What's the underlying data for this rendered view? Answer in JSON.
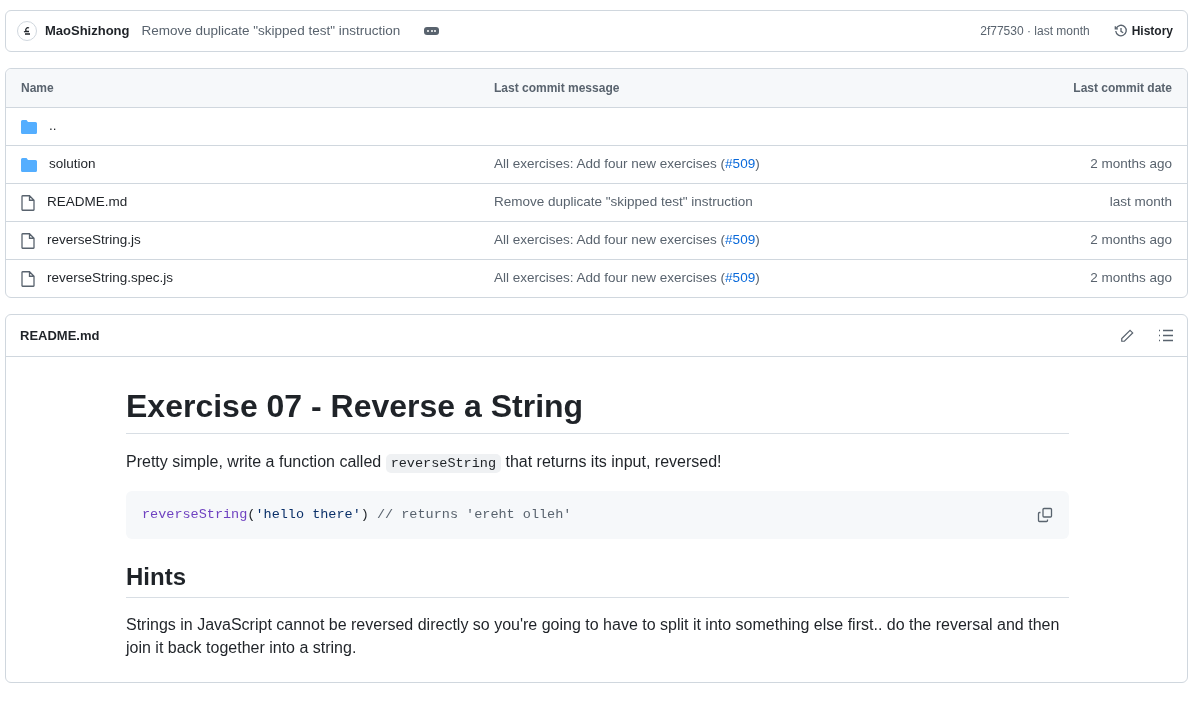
{
  "commit_bar": {
    "author": "MaoShizhong",
    "message": "Remove duplicate \"skipped test\" instruction",
    "meta": "2f77530 · last month",
    "history_button": "History"
  },
  "table": {
    "columns": [
      "Name",
      "Last commit message",
      "Last commit date"
    ],
    "rows": [
      {
        "kind": "folder",
        "name": ".."
      },
      {
        "kind": "folder",
        "name": "solution",
        "message": "All exercises: Add four new exercises (",
        "link": "#509",
        "after": ")",
        "date": "2 months ago"
      },
      {
        "kind": "file",
        "name": "README.md",
        "message": "Remove duplicate \"skipped test\" instruction",
        "date": "last month"
      },
      {
        "kind": "file",
        "name": "reverseString.js",
        "message": "All exercises: Add four new exercises (",
        "link": "#509",
        "after": ")",
        "date": "2 months ago"
      },
      {
        "kind": "file",
        "name": "reverseString.spec.js",
        "message": "All exercises: Add four new exercises (",
        "link": "#509",
        "after": ")",
        "date": "2 months ago"
      }
    ]
  },
  "readme": {
    "title": "README.md",
    "heading": "Exercise 07 - Reverse a String",
    "intro": {
      "before": "Pretty simple, write a function called ",
      "code": "reverseString",
      "after": " that returns its input, reversed!"
    },
    "code": [
      {
        "kind": "function",
        "text": "reverseString"
      },
      {
        "kind": "plain",
        "text": "("
      },
      {
        "kind": "string",
        "text": "'hello there'"
      },
      {
        "kind": "plain",
        "text": ") "
      },
      {
        "kind": "comment",
        "text": "// returns 'ereht olleh'"
      }
    ],
    "subheading": "Hints",
    "hint": "Strings in JavaScript cannot be reversed directly so you're going to have to split it into something else first.. do the reversal and then join it back together into a string."
  }
}
